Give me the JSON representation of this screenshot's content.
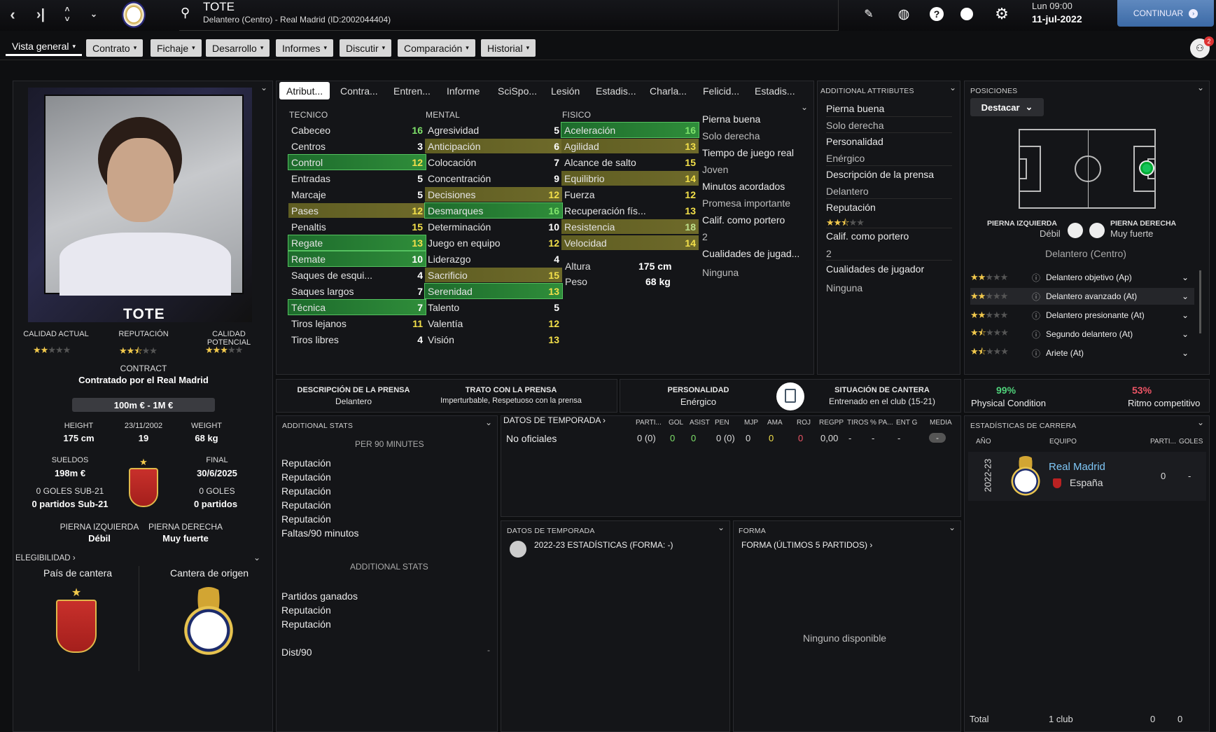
{
  "topbar": {
    "name": "TOTE",
    "subtitle": "Delantero (Centro) - Real Madrid (ID:2002044404)",
    "date_day": "Lun 09:00",
    "date": "11-jul-2022",
    "continue": "CONTINUAR",
    "notif_count": "2"
  },
  "tabs": [
    {
      "label": "Vista general"
    },
    {
      "label": "Contrato"
    },
    {
      "label": "Fichaje"
    },
    {
      "label": "Desarrollo"
    },
    {
      "label": "Informes"
    },
    {
      "label": "Discutir"
    },
    {
      "label": "Comparación"
    },
    {
      "label": "Historial"
    }
  ],
  "profile": {
    "name": "TOTE",
    "ca_label": "CALIDAD ACTUAL",
    "rep_label": "REPUTACIÓN",
    "pa_label": "CALIDAD POTENCIAL",
    "ca_stars": 2,
    "rep_stars": 2.5,
    "pa_stars": 3,
    "contract_label": "CONTRACT",
    "contract": "Contratado por el Real Madrid",
    "value": "100m € - 1M €",
    "height_label": "HEIGHT",
    "height": "175 cm",
    "dob": "23/11/2002",
    "age": "19",
    "weight_label": "WEIGHT",
    "weight": "68 kg",
    "wages_label": "SUELDOS",
    "wages": "198m €",
    "final_label": "FINAL",
    "final": "30/6/2025",
    "u21_goals": "0 GOLES SUB-21",
    "u21_matches": "0 partidos Sub-21",
    "goals": "0 GOLES",
    "matches": "0 partidos",
    "left_foot_label": "PIERNA IZQUIERDA",
    "left_foot": "Débil",
    "right_foot_label": "PIERNA DERECHA",
    "right_foot": "Muy fuerte",
    "eligibility": "ELEGIBILIDAD",
    "youth_country": "País de cantera",
    "youth_club": "Cantera de origen"
  },
  "subtabs": [
    "Atribut...",
    "Contra...",
    "Entren...",
    "Informe",
    "SciSpo...",
    "Lesión",
    "Estadis...",
    "Charla...",
    "Felicid...",
    "Estadis..."
  ],
  "attributes": {
    "tec_label": "TECNICO",
    "men_label": "MENTAL",
    "fis_label": "FISICO",
    "tecnico": [
      [
        "Cabeceo",
        "16",
        "g",
        ""
      ],
      [
        "Centros",
        "3",
        "w",
        ""
      ],
      [
        "Control",
        "12",
        "y",
        "green"
      ],
      [
        "Entradas",
        "5",
        "w",
        ""
      ],
      [
        "Marcaje",
        "5",
        "w",
        ""
      ],
      [
        "Pases",
        "12",
        "y",
        "olive"
      ],
      [
        "Penaltis",
        "15",
        "y",
        ""
      ],
      [
        "Regate",
        "13",
        "y",
        "green"
      ],
      [
        "Remate",
        "10",
        "w",
        "green"
      ],
      [
        "Saques de esqui...",
        "4",
        "w",
        ""
      ],
      [
        "Saques largos",
        "7",
        "w",
        ""
      ],
      [
        "Técnica",
        "7",
        "w",
        "green"
      ],
      [
        "Tiros lejanos",
        "11",
        "y",
        ""
      ],
      [
        "Tiros libres",
        "4",
        "w",
        ""
      ]
    ],
    "mental": [
      [
        "Agresividad",
        "5",
        "w",
        ""
      ],
      [
        "Anticipación",
        "6",
        "w",
        "olive"
      ],
      [
        "Colocación",
        "7",
        "w",
        ""
      ],
      [
        "Concentración",
        "9",
        "w",
        ""
      ],
      [
        "Decisiones",
        "12",
        "y",
        "olive"
      ],
      [
        "Desmarques",
        "16",
        "g",
        "green"
      ],
      [
        "Determinación",
        "10",
        "w",
        ""
      ],
      [
        "Juego en equipo",
        "12",
        "y",
        ""
      ],
      [
        "Liderazgo",
        "4",
        "w",
        ""
      ],
      [
        "Sacrificio",
        "15",
        "y",
        "olive"
      ],
      [
        "Serenidad",
        "13",
        "y",
        "green"
      ],
      [
        "Talento",
        "5",
        "w",
        ""
      ],
      [
        "Valentía",
        "12",
        "y",
        ""
      ],
      [
        "Visión",
        "13",
        "y",
        ""
      ]
    ],
    "fisico": [
      [
        "Aceleración",
        "16",
        "g",
        "green"
      ],
      [
        "Agilidad",
        "13",
        "y",
        "olive"
      ],
      [
        "Alcance de salto",
        "15",
        "y",
        ""
      ],
      [
        "Equilibrio",
        "14",
        "y",
        "olive"
      ],
      [
        "Fuerza",
        "12",
        "y",
        ""
      ],
      [
        "Recuperación fís...",
        "13",
        "y",
        ""
      ],
      [
        "Resistencia",
        "18",
        "gg",
        "olive"
      ],
      [
        "Velocidad",
        "14",
        "y",
        "olive"
      ]
    ],
    "height_label": "Altura",
    "height": "175 cm",
    "weight_label": "Peso",
    "weight": "68 kg",
    "side": [
      "Pierna buena",
      "Solo derecha",
      "Tiempo de juego real",
      "Joven",
      "Minutos acordados",
      "Promesa importante",
      "Calif. como portero",
      "2",
      "Cualidades de jugad...",
      "Ninguna"
    ]
  },
  "additional": {
    "title": "ADDITIONAL ATTRIBUTES",
    "items": [
      "Pierna buena",
      "Solo derecha",
      "Personalidad",
      "Enérgico",
      "Descripción de la prensa",
      "Delantero",
      "Reputación",
      "Calif. como portero",
      "2",
      "Cualidades de jugador",
      "Ninguna"
    ]
  },
  "positions": {
    "title": "POSICIONES",
    "button": "Destacar",
    "lf_label": "PIERNA IZQUIERDA",
    "lf": "Débil",
    "rf_label": "PIERNA DERECHA",
    "rf": "Muy fuerte",
    "role": "Delantero (Centro)",
    "roles": [
      [
        "Delantero objetivo (Ap)",
        2
      ],
      [
        "Delantero avanzado (At)",
        2
      ],
      [
        "Delantero presionante (At)",
        2
      ],
      [
        "Segundo delantero (At)",
        1.5
      ],
      [
        "Ariete (At)",
        1.5
      ]
    ]
  },
  "press": {
    "desc_label": "DESCRIPCIÓN DE LA PRENSA",
    "desc": "Delantero",
    "trato_label": "TRATO CON LA PRENSA",
    "trato": "Imperturbable, Respetuoso con la prensa",
    "pers_label": "PERSONALIDAD",
    "pers": "Enérgico",
    "cant_label": "SITUACIÓN DE CANTERA",
    "cant": "Entrenado en el club (15-21)"
  },
  "condition": {
    "phys": "99%",
    "phys_label": "Physical Condition",
    "ritmo": "53%",
    "ritmo_label": "Ritmo competitivo"
  },
  "addstats": {
    "title": "ADDITIONAL STATS",
    "per90": "PER 90 MINUTES",
    "list1": [
      "Reputación",
      "Reputación",
      "Reputación",
      "Reputación",
      "Reputación",
      "Faltas/90 minutos"
    ],
    "title2": "ADDITIONAL STATS",
    "list2": [
      "Partidos ganados",
      "Reputación",
      "Reputación"
    ],
    "dist": "Dist/90",
    "dist_val": "-"
  },
  "season": {
    "title": "DATOS DE TEMPORADA",
    "cols": [
      "PARTI...",
      "GOL",
      "ASIST",
      "PEN",
      "MJP",
      "AMA",
      "ROJ",
      "REGPP",
      "TIROS",
      "% PA...",
      "ENT G",
      "MEDIA"
    ],
    "row_label": "No oficiales",
    "row": [
      "0 (0)",
      "0",
      "0",
      "0 (0)",
      "0",
      "0",
      "0",
      "0,00",
      "-",
      "-",
      "-",
      "-"
    ]
  },
  "season2": {
    "title": "DATOS DE TEMPORADA",
    "line": "2022-23 ESTADÍSTICAS (FORMA: -)"
  },
  "form": {
    "title": "FORMA",
    "sub": "FORMA (ÚLTIMOS 5 PARTIDOS)",
    "empty": "Ninguno disponible"
  },
  "career": {
    "title": "ESTADÍSTICAS DE CARRERA",
    "col_year": "AÑO",
    "col_team": "EQUIPO",
    "col_part": "PARTI...",
    "col_goals": "GOLES",
    "year": "2022-23",
    "team": "Real Madrid",
    "country": "España",
    "part": "0",
    "goals": "-",
    "total": "Total",
    "total_clubs": "1 club",
    "total_part": "0",
    "total_goals": "0"
  }
}
